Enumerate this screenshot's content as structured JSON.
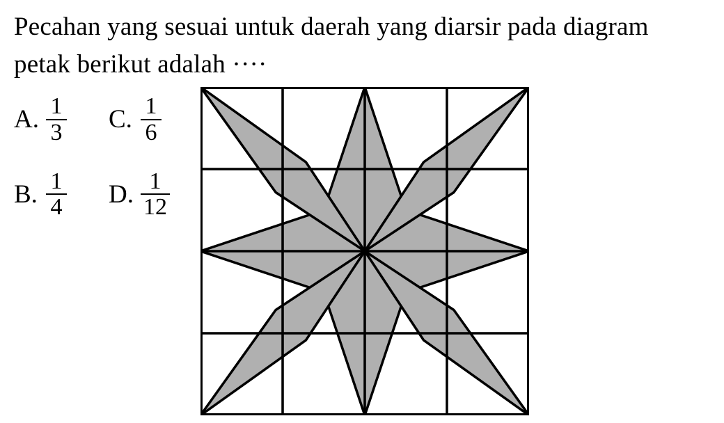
{
  "question": {
    "text": "Pecahan yang sesuai untuk daerah yang diarsir pada diagram petak berikut adalah ····"
  },
  "options": [
    {
      "letter": "A.",
      "num": "1",
      "den": "3"
    },
    {
      "letter": "B.",
      "num": "1",
      "den": "4"
    },
    {
      "letter": "C.",
      "num": "1",
      "den": "6"
    },
    {
      "letter": "D.",
      "num": "1",
      "den": "12"
    }
  ],
  "diagram": {
    "grid_size": 4,
    "shaded_shape": "8-point-star",
    "fill": "#b0b0b0",
    "stroke": "#000"
  }
}
